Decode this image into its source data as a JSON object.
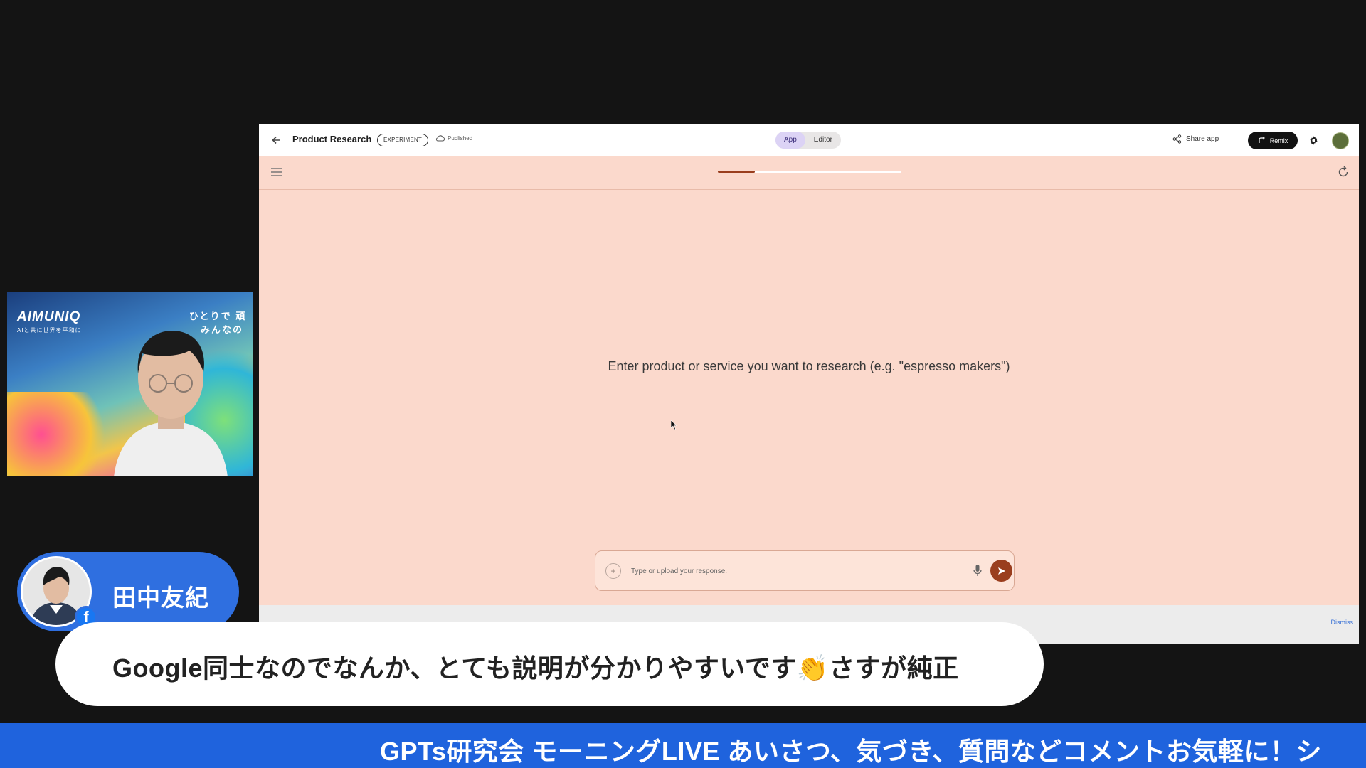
{
  "app": {
    "title": "Product Research",
    "badge": "EXPERIMENT",
    "status": "Published",
    "mode_tabs": [
      {
        "label": "App",
        "active": true
      },
      {
        "label": "Editor",
        "active": false
      }
    ],
    "share_label": "Share app",
    "remix_label": "Remix",
    "progress_fraction": 0.2,
    "prompt": "Enter product or service you want to research (e.g. \"espresso makers\")",
    "composer": {
      "placeholder": "Type or upload your response."
    },
    "footer": {
      "dismiss_label": "Dismiss"
    },
    "colors": {
      "canvas": "#fbd9cc",
      "accent": "#9a3e1e",
      "active_tab": "#dcd3f5"
    }
  },
  "webcam": {
    "brand": "AIMUNIQ",
    "brand_sub": "AIと共に世界を平和に！",
    "tagline_1": "ひとりで 頑",
    "tagline_2": "みんなの"
  },
  "speaker": {
    "name": "田中友紀",
    "social_icon": "facebook-icon"
  },
  "comment": {
    "text": "Google同士なのでなんか、とても説明が分かりやすいです👏さすが純正"
  },
  "ticker": {
    "text": "GPTs研究会 モーニングLIVE あいさつ、気づき、質問などコメントお気軽に！シ"
  }
}
